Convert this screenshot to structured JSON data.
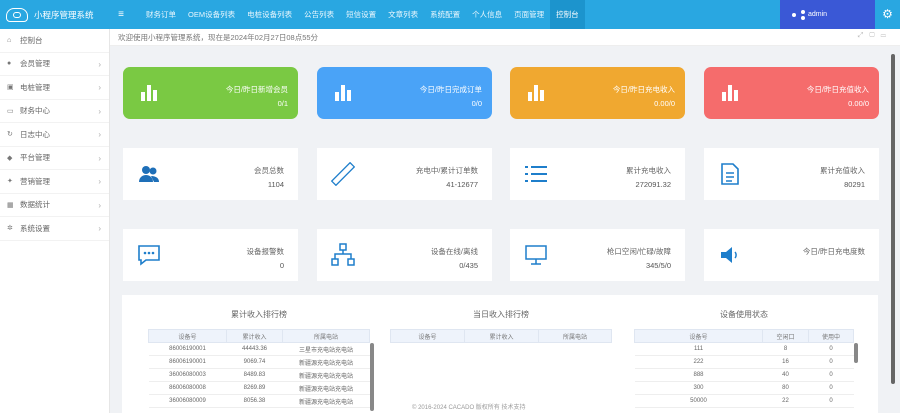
{
  "app": {
    "title": "小程序管理系统"
  },
  "topnav": [
    "财务订单",
    "OEM设备列表",
    "电桩设备列表",
    "公告列表",
    "短信设置",
    "文章列表",
    "系统配置",
    "个人信息",
    "页面管理",
    "控制台"
  ],
  "user": {
    "name": "admin"
  },
  "sidebar": {
    "items": [
      {
        "label": "控制台",
        "icon": "home-icon"
      },
      {
        "label": "会员管理",
        "icon": "user-icon"
      },
      {
        "label": "电桩管理",
        "icon": "cube-icon"
      },
      {
        "label": "财务中心",
        "icon": "monitor-icon"
      },
      {
        "label": "日志中心",
        "icon": "refresh-icon"
      },
      {
        "label": "平台管理",
        "icon": "chat-icon"
      },
      {
        "label": "营销管理",
        "icon": "gift-icon"
      },
      {
        "label": "数据统计",
        "icon": "chart-icon"
      },
      {
        "label": "系统设置",
        "icon": "gear-icon"
      }
    ]
  },
  "welcome": "欢迎使用小程序管理系统，现在是2024年02月27日08点55分",
  "stat_cards": [
    {
      "label": "今日/昨日新增会员",
      "value": "0/1",
      "color": "#7ac943"
    },
    {
      "label": "今日/昨日完成订单",
      "value": "0/0",
      "color": "#4aa3f7"
    },
    {
      "label": "今日/昨日充电收入",
      "value": "0.00/0",
      "color": "#f0a830"
    },
    {
      "label": "今日/昨日充值收入",
      "value": "0.00/0",
      "color": "#f56c6c"
    }
  ],
  "info_cards": [
    {
      "label": "会员总数",
      "value": "1104",
      "icon": "users-icon"
    },
    {
      "label": "充电中/累计订单数",
      "value": "41-12677",
      "icon": "ruler-icon"
    },
    {
      "label": "累计充电收入",
      "value": "272091.32",
      "icon": "list-icon"
    },
    {
      "label": "累计充值收入",
      "value": "80291",
      "icon": "document-icon"
    },
    {
      "label": "设备报警数",
      "value": "0",
      "icon": "message-icon"
    },
    {
      "label": "设备在线/离线",
      "value": "0/435",
      "icon": "network-icon"
    },
    {
      "label": "枪口空闲/忙碌/故障",
      "value": "345/5/0",
      "icon": "screen-icon"
    },
    {
      "label": "今日/昨日充电度数",
      "value": "",
      "icon": "speaker-icon"
    }
  ],
  "tables": {
    "income": {
      "title": "累计收入排行榜",
      "headers": [
        "设备号",
        "累计收入",
        "所属电站"
      ],
      "rows": [
        [
          "86006190001",
          "44443.36",
          "三星市充电站充电站"
        ],
        [
          "86006190001",
          "9069.74",
          "新疆源充电站充电站"
        ],
        [
          "36006080003",
          "8489.83",
          "新疆源充电站充电站"
        ],
        [
          "86006080008",
          "8269.89",
          "新疆源充电站充电站"
        ],
        [
          "36006080009",
          "8056.38",
          "新疆源充电站充电站"
        ]
      ]
    },
    "today": {
      "title": "当日收入排行榜",
      "headers": [
        "设备号",
        "累计收入",
        "所属电站"
      ],
      "rows": []
    },
    "status": {
      "title": "设备使用状态",
      "headers": [
        "设备号",
        "空闲口",
        "使用中"
      ],
      "rows": [
        [
          "111",
          "8",
          "0"
        ],
        [
          "222",
          "16",
          "0"
        ],
        [
          "888",
          "40",
          "0"
        ],
        [
          "300",
          "80",
          "0"
        ],
        [
          "50000",
          "22",
          "0"
        ]
      ]
    }
  },
  "footer": "© 2016-2024 CACADO 版权所有 技术支持"
}
